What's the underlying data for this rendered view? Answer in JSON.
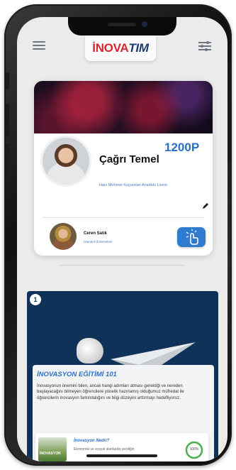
{
  "header": {
    "logo_part1": "İNOVA",
    "logo_part2": "TIM",
    "menu_icon": "hamburger-icon",
    "filter_icon": "sliders-icon"
  },
  "profile": {
    "name": "Çağrı Temel",
    "school": "Hacı Mehmet Koçarslan Anadolu Lisesi",
    "points": "1200P",
    "edit_icon": "pencil-icon"
  },
  "mentor": {
    "name": "Ceren Satık",
    "school": "İstanbul Üniversitesi",
    "action_icon": "touch-icon"
  },
  "course": {
    "number": "1",
    "title": "İNOVASYON EĞİTİMİ 101",
    "description": "İnovasyonun önemini bilen, ancak hangi adımları atması gerektiği ve nereden başlayacağını bilmeyen öğrencilere yönelik hazırlamış olduğumuz müfredat ile öğrencilerin inovasyon farkındalığını ve bilgi düzeyini arttırmayı hedefliyoruz.",
    "subcard": {
      "thumb_label": "İNOVASYON",
      "title": "İnovasyon Nedir?",
      "text": "Ekonomik ve sosyal alanlarda yeniliğin",
      "progress": "100%"
    }
  },
  "colors": {
    "accent_blue": "#2e7bd0",
    "brand_red": "#d7262f",
    "card_dark": "#0f3258"
  }
}
